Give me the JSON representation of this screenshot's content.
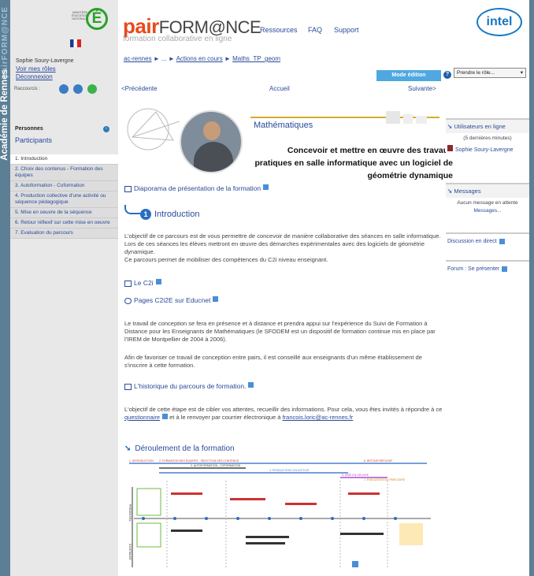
{
  "sidebar_band": {
    "brand": "pairFORM@NCE",
    "academy": "Académie de Rennes"
  },
  "logo": {
    "ministry_lines": "MINISTÈRE ÉDUCATION NATIONALE",
    "letter": "É"
  },
  "user": {
    "name": "Sophie Soury-Lavergne",
    "roles_link": "Voir mes rôles",
    "logout": "Déconnexion",
    "shortcuts": "Raccourcis :"
  },
  "people": {
    "title": "Personnes",
    "participants": "Participants",
    "collapse": "-"
  },
  "nav": [
    "1. Introduction",
    "2. Choix des contenus - Formation des équipes",
    "3. Autoformation - Coformation",
    "4. Production collective d'une activité ou séquence pédagogique",
    "5. Mise en oeuvre de la séquence",
    "6. Retour réflexif sur cette mise en oeuvre",
    "7. Evaluation du parcours"
  ],
  "header": {
    "brand_a": "pair",
    "brand_b": "FORM@NCE",
    "subtitle": "formation collaborative en ligne",
    "links": [
      "Ressources",
      "FAQ",
      "Support"
    ],
    "intel": "intel"
  },
  "breadcrumb": {
    "home": "ac-rennes",
    "sep": "►",
    "ellipsis": "...",
    "item1": "Actions en cours",
    "item2": "Maths_TP_geom"
  },
  "toolbar": {
    "mode": "Mode édition",
    "help": "?",
    "role": "Prendre le rôle...",
    "prev": "<Précédente",
    "home": "Accueil",
    "next": "Suivante>"
  },
  "banner": {
    "subject": "Mathématiques",
    "title": "Concevoir et mettre en œuvre des travaux pratiques en salle informatique avec un logiciel de géométrie dynamique"
  },
  "content": {
    "slideshow": "Diaporama de présentation de la formation",
    "intro_num": "1",
    "intro": "Introduction",
    "p1": "L'objectif de ce parcours est de vous permettre de concevoir de manière collaborative des séances en salle informatique. Lors de ces séances les élèves mettront en œuvre des démarches expérimentales avec des logiciels de géométrie dynamique.",
    "p1b": "Ce parcours permet de mobiliser des compétences du C2i niveau enseignant.",
    "c2i": "Le C2i",
    "c2i2e": "Pages C2i2E sur Educnet",
    "p2": "Le travail de conception se fera en présence et à distance et prendra appui sur l'expérience du Suivi de Formation à Distance pour les Enseignants de Mathématiques (le SFODEM est un dispositif de formation continue mis en place par l'IREM de Montpellier de 2004 à 2006).",
    "p3": "Afin de favoriser ce travail de conception entre pairs, il est conseillé aux enseignants d'un même établissement de s'inscrire à cette formation.",
    "history": "L'historique du parcours de formation.",
    "p4a": "L'objectif de cette étape est de cibler vos attentes, recueillir des informations. Pour cela, vous êtes invités à répondre à ce",
    "p4link": "questionnaire",
    "p4b": "et à le renvoyer par courrier électronique à",
    "email": "francois.loric@ac-rennes.fr",
    "deroulement": "Déroulement de la formation"
  },
  "diagram": {
    "phases": [
      "1. INTRODUCTION",
      "2. FORMATION DES ÉQUIPES - SÉLECTION DES CONTENUS",
      "3. AUTOFORMATION - COFORMATION",
      "4. PRODUCTION COLLECTIVE",
      "5. MISE EN OEUVRE",
      "6. RETOUR RÉFLEXIF",
      "7. ÉVALUATION DU PARCOURS"
    ],
    "row_present": "PRÉSENTIEL",
    "row_distance": "À DISTANCE"
  },
  "right": {
    "online_title": "Utilisateurs en ligne",
    "online_sub": "(5 dernières minutes)",
    "online_user": "Sophie Soury-Lavergne",
    "messages_title": "Messages",
    "messages_text": "Aucun message en attente",
    "messages_link": "Messages...",
    "chat": "Discussion en direct",
    "forum": "Forum : Se présenter"
  }
}
